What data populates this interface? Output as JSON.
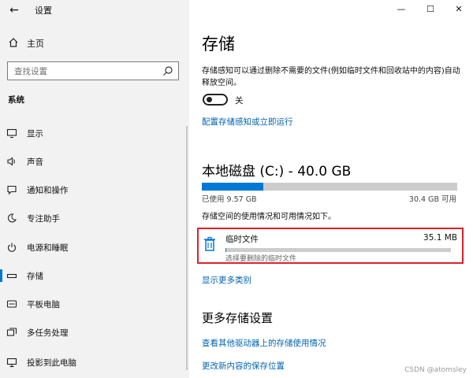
{
  "window": {
    "app_title": "设置",
    "back_label": "←",
    "minimize_label": "—",
    "maximize_label": "☐",
    "close_label": "✕"
  },
  "sidebar": {
    "home_label": "主页",
    "search_placeholder": "查找设置",
    "section_label": "系统",
    "items": [
      {
        "label": "显示",
        "icon": "display-icon"
      },
      {
        "label": "声音",
        "icon": "speaker-icon"
      },
      {
        "label": "通知和操作",
        "icon": "notification-icon"
      },
      {
        "label": "专注助手",
        "icon": "moon-icon"
      },
      {
        "label": "电源和睡眠",
        "icon": "power-icon"
      },
      {
        "label": "存储",
        "icon": "storage-icon",
        "active": true
      },
      {
        "label": "平板电脑",
        "icon": "tablet-icon"
      },
      {
        "label": "多任务处理",
        "icon": "multitask-icon"
      },
      {
        "label": "投影到此电脑",
        "icon": "project-icon"
      }
    ]
  },
  "main": {
    "title": "存储",
    "storage_sense_desc": "存储感知可以通过删除不需要的文件(例如临时文件和回收站中的内容)自动释放空间。",
    "toggle_state_label": "关",
    "configure_link": "配置存储感知或立即运行",
    "drive": {
      "title": "本地磁盘 (C:) - 40.0 GB",
      "used_label": "已使用 9.57 GB",
      "available_label": "30.4 GB 可用",
      "used_fraction": 0.24
    },
    "usage_desc": "存储空间的使用情况和可用情况如下。",
    "temp_files": {
      "name": "临时文件",
      "size": "35.1 MB",
      "subtitle": "选择要删除的临时文件",
      "fraction": 0.002
    },
    "show_more_link": "显示更多类别",
    "more_settings_title": "更多存储设置",
    "other_drives_link": "查看其他驱动器上的存储使用情况",
    "change_location_link": "更改新内容的保存位置"
  },
  "watermark": "CSDN @atomsley",
  "colors": {
    "accent": "#0078d7",
    "link": "#0063b1",
    "highlight_border": "#e0202a"
  }
}
